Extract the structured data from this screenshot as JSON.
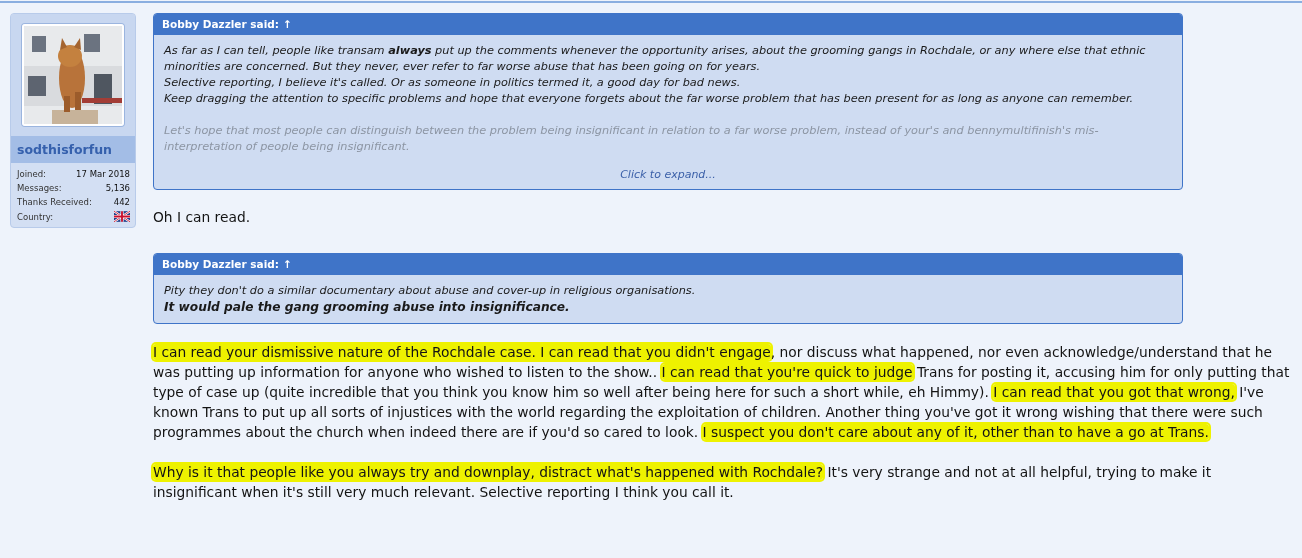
{
  "user": {
    "username": "sodthisforfun",
    "stats": [
      {
        "kind": "text",
        "label": "Joined:",
        "value": "17 Mar 2018"
      },
      {
        "kind": "text",
        "label": "Messages:",
        "value": "5,136"
      },
      {
        "kind": "text",
        "label": "Thanks Received:",
        "value": "442"
      },
      {
        "kind": "flag",
        "label": "Country:"
      }
    ]
  },
  "blocks": [
    {
      "kind": "quote",
      "author": "Bobby Dazzler said:",
      "arrow": "↑",
      "collapsed": true,
      "expand_link": "Click to expand...",
      "paragraphs": [
        {
          "lines": [
            {
              "text": "As far as I can tell, people like transam **always** put up the comments whenever the opportunity arises, about the grooming gangs in Rochdale, or any where else that ethnic minorities are concerned. But they never, ever refer to far worse abuse that has been going on for years.",
              "bold": false,
              "faded": false
            },
            {
              "text": "Selective reporting, I believe it's called. Or as someone in politics termed it, a good day for bad news.",
              "bold": false,
              "faded": false
            },
            {
              "text": "Keep dragging the attention to specific problems and hope that everyone forgets about the far worse problem that has been present for as long as anyone can remember.",
              "bold": false,
              "faded": false
            }
          ]
        },
        {
          "lines": [
            {
              "text": "Let's hope that most people can distinguish between the problem being insignificant in relation to a far worse problem, instead of your's and bennymultifinish's mis-interpretation of people being insignificant.",
              "bold": false,
              "faded": true
            }
          ]
        }
      ]
    },
    {
      "kind": "paragraph",
      "segments": [
        {
          "text": "Oh I can read.",
          "highlighted": false
        }
      ]
    },
    {
      "kind": "quote",
      "author": "Bobby Dazzler said:",
      "arrow": "↑",
      "collapsed": false,
      "paragraphs": [
        {
          "lines": [
            {
              "text": "Pity they don't do a similar documentary about abuse and cover-up in religious organisations.",
              "bold": false,
              "faded": false
            },
            {
              "text": "It would pale the gang grooming abuse into insignificance.",
              "bold": true,
              "faded": false
            }
          ]
        }
      ]
    },
    {
      "kind": "paragraph",
      "segments": [
        {
          "text": "I can read your dismissive nature of the Rochdale case. I can read that you didn't engage",
          "highlighted": true
        },
        {
          "text": ", nor discuss what happened, nor even acknowledge/understand that he was putting up information for anyone who wished to listen to the show.. ",
          "highlighted": false
        },
        {
          "text": "I can read that you're quick to judge",
          "highlighted": true
        },
        {
          "text": " Trans for posting it, accusing him for only putting that type of case up (quite incredible that you think you know him so well after being here for such a short while, eh Himmy). ",
          "highlighted": false
        },
        {
          "text": "I can read that you got that wrong,",
          "highlighted": true
        },
        {
          "text": " I've known Trans to put up all sorts of injustices with the world regarding the exploitation of children. Another thing you've got it wrong wishing that there were such programmes about the church when indeed there are if you'd so cared to look. ",
          "highlighted": false
        },
        {
          "text": "I suspect you don't care about any of it, other than to have a go at Trans.",
          "highlighted": true
        }
      ]
    },
    {
      "kind": "paragraph",
      "segments": [
        {
          "text": "Why is it that people like you always try and downplay, distract what's happened with Rochdale?",
          "highlighted": true
        },
        {
          "text": " It's very strange and not at all helpful, trying to make it insignificant when it's still very much relevant. Selective reporting I think you call it.",
          "highlighted": false
        }
      ]
    }
  ]
}
